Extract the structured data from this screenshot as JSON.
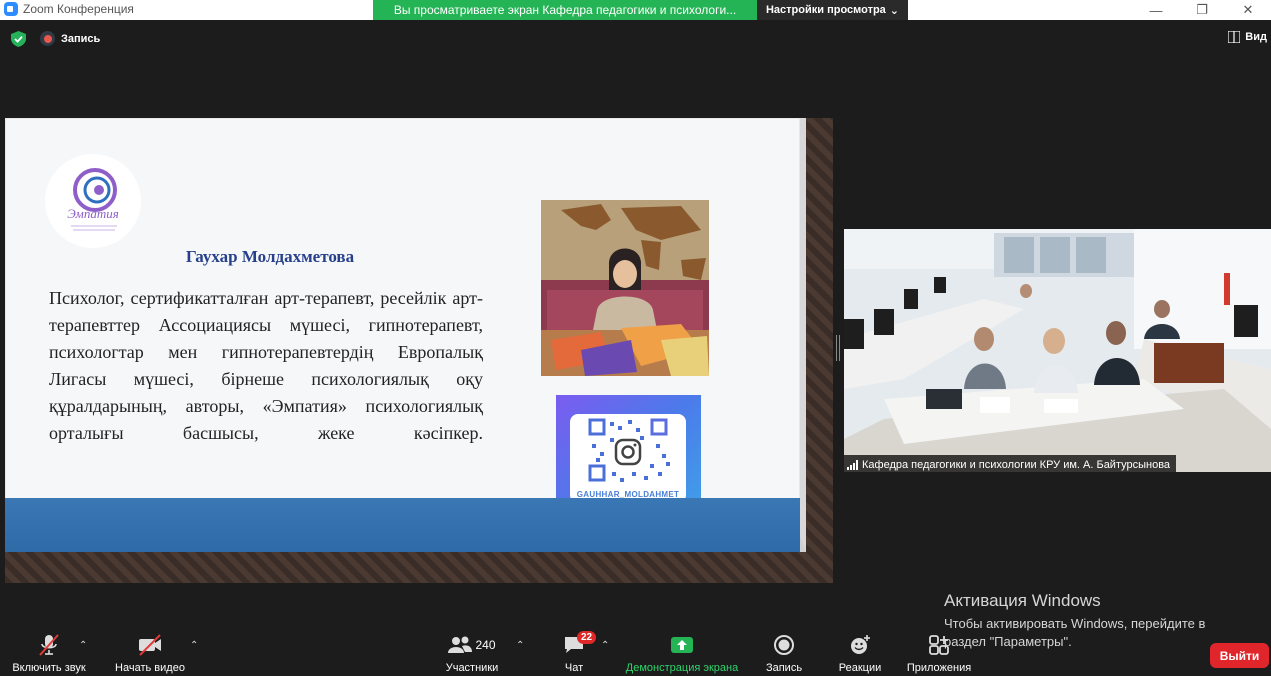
{
  "window": {
    "title": "Zoom Конференция",
    "share_banner": "Вы просматриваете экран Кафедра педагогики и психологи...",
    "view_options": "Настройки просмотра"
  },
  "topbar": {
    "record_label": "Запись",
    "view_label": "Вид"
  },
  "slide": {
    "logo_text": "Эмпатия",
    "speaker_name": "Гаухар Молдахметова",
    "bio": "Психолог, сертификатталған арт-терапевт, ресейлік арт-терапевттер Ассоциациясы мүшесі, гипнотерапевт, психологтар мен гипнотерапевтердің Европалық Лигасы мүшесі, бірнеше психологиялық оқу құралдарының, авторы, «Эмпатия» психологиялық орталығы басшысы, жеке кәсіпкер.",
    "qr_handle": "GAUHHAR_MOLDAHMET"
  },
  "participant_video": {
    "name": "Кафедра педагогики и психологии КРУ им. А. Байтурсынова"
  },
  "windows_activation": {
    "title": "Активация Windows",
    "line1": "Чтобы активировать Windows, перейдите в",
    "line2": "раздел \"Параметры\"."
  },
  "toolbar": {
    "unmute": "Включить звук",
    "start_video": "Начать видео",
    "participants": "Участники",
    "participants_count": "240",
    "chat": "Чат",
    "chat_badge": "22",
    "share_screen": "Демонстрация экрана",
    "record": "Запись",
    "reactions": "Реакции",
    "apps": "Приложения",
    "exit": "Выйти"
  },
  "colors": {
    "share_green": "#25b455",
    "toolbar_bg": "#1c1c1c",
    "exit_red": "#e0262b",
    "slide_band": "#3a77b5"
  }
}
